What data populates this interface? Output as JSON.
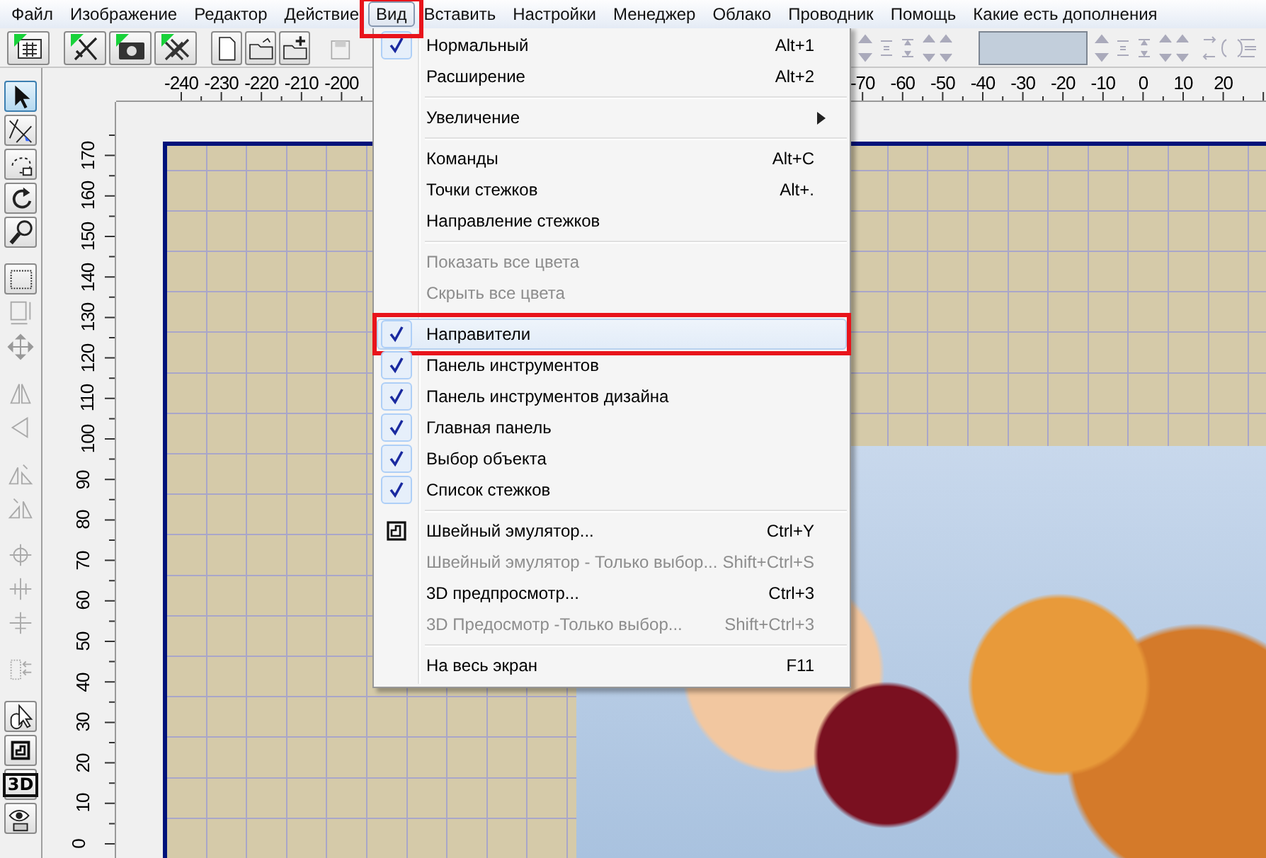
{
  "menubar": [
    {
      "label": "Файл",
      "selected": false,
      "annotated": false
    },
    {
      "label": "Изображение",
      "selected": false,
      "annotated": false
    },
    {
      "label": "Редактор",
      "selected": false,
      "annotated": false
    },
    {
      "label": "Действие",
      "selected": false,
      "annotated": false
    },
    {
      "label": "Вид",
      "selected": true,
      "annotated": true
    },
    {
      "label": "Вставить",
      "selected": false,
      "annotated": false
    },
    {
      "label": "Настройки",
      "selected": false,
      "annotated": false
    },
    {
      "label": "Менеджер",
      "selected": false,
      "annotated": false
    },
    {
      "label": "Облако",
      "selected": false,
      "annotated": false
    },
    {
      "label": "Проводник",
      "selected": false,
      "annotated": false
    },
    {
      "label": "Помощь",
      "selected": false,
      "annotated": false
    },
    {
      "label": "Какие есть дополнения",
      "selected": false,
      "annotated": false
    }
  ],
  "toolbar": {
    "buttons": [
      {
        "disabled": false
      },
      {
        "disabled": false
      },
      {
        "disabled": false
      },
      {
        "disabled": false
      },
      {
        "disabled": false
      },
      {
        "disabled": false
      },
      {
        "disabled": false
      },
      {
        "disabled": true
      }
    ]
  },
  "tools": [
    {
      "kind": "tool",
      "selected": true,
      "disabled": false
    },
    {
      "kind": "tool",
      "selected": false,
      "disabled": false
    },
    {
      "kind": "tool",
      "selected": false,
      "disabled": false
    },
    {
      "kind": "tool",
      "selected": false,
      "disabled": false
    },
    {
      "kind": "tool",
      "selected": false,
      "disabled": false
    },
    {
      "kind": "gap"
    },
    {
      "kind": "tool",
      "selected": false,
      "disabled": false
    },
    {
      "kind": "tool",
      "selected": false,
      "disabled": true
    },
    {
      "kind": "tool",
      "selected": false,
      "disabled": true
    },
    {
      "kind": "gap"
    },
    {
      "kind": "tool",
      "selected": false,
      "disabled": true
    },
    {
      "kind": "tool",
      "selected": false,
      "disabled": true
    },
    {
      "kind": "gap"
    },
    {
      "kind": "tool",
      "selected": false,
      "disabled": true
    },
    {
      "kind": "tool",
      "selected": false,
      "disabled": true
    },
    {
      "kind": "gap"
    },
    {
      "kind": "tool",
      "selected": false,
      "disabled": true
    },
    {
      "kind": "tool",
      "selected": false,
      "disabled": true
    },
    {
      "kind": "tool",
      "selected": false,
      "disabled": true
    },
    {
      "kind": "gap"
    },
    {
      "kind": "tool",
      "selected": false,
      "disabled": true
    },
    {
      "kind": "gap"
    },
    {
      "kind": "tool",
      "selected": false,
      "disabled": false
    },
    {
      "kind": "tool",
      "selected": false,
      "disabled": false
    },
    {
      "kind": "text_tool",
      "label": "3D",
      "selected": false,
      "disabled": false
    },
    {
      "kind": "tool",
      "selected": false,
      "disabled": false
    }
  ],
  "ruler_h": [
    "-240",
    "-230",
    "-220",
    "-210",
    "-200",
    "-70",
    "-60",
    "-50",
    "-40",
    "-30",
    "-20",
    "-10",
    "0",
    "10",
    "20"
  ],
  "ruler_v": [
    "170",
    "160",
    "150",
    "140",
    "130",
    "120",
    "110",
    "100",
    "90",
    "80",
    "70",
    "60",
    "50",
    "40",
    "30",
    "20",
    "10",
    "0"
  ],
  "menu": [
    {
      "kind": "item",
      "label": "Нормальный",
      "shortcut": "Alt+1",
      "checked": true,
      "disabled": false,
      "highlighted": false,
      "submenu": false,
      "annotated": false
    },
    {
      "kind": "item",
      "label": "Расширение",
      "shortcut": "Alt+2",
      "checked": false,
      "disabled": false,
      "highlighted": false,
      "submenu": false,
      "annotated": false
    },
    {
      "kind": "separator"
    },
    {
      "kind": "item",
      "label": "Увеличение",
      "checked": false,
      "disabled": false,
      "highlighted": false,
      "submenu": true,
      "annotated": false
    },
    {
      "kind": "separator"
    },
    {
      "kind": "item",
      "label": "Команды",
      "shortcut": "Alt+C",
      "checked": false,
      "disabled": false,
      "highlighted": false,
      "submenu": false,
      "annotated": false
    },
    {
      "kind": "item",
      "label": "Точки стежков",
      "shortcut": "Alt+.",
      "checked": false,
      "disabled": false,
      "highlighted": false,
      "submenu": false,
      "annotated": false
    },
    {
      "kind": "item",
      "label": "Направление стежков",
      "checked": false,
      "disabled": false,
      "highlighted": false,
      "submenu": false,
      "annotated": false
    },
    {
      "kind": "separator"
    },
    {
      "kind": "item",
      "label": "Показать все цвета",
      "checked": false,
      "disabled": true,
      "highlighted": false,
      "submenu": false,
      "annotated": false
    },
    {
      "kind": "item",
      "label": "Скрыть все цвета",
      "checked": false,
      "disabled": true,
      "highlighted": false,
      "submenu": false,
      "annotated": false
    },
    {
      "kind": "separator"
    },
    {
      "kind": "item",
      "label": "Направители",
      "checked": true,
      "disabled": false,
      "highlighted": true,
      "submenu": false,
      "annotated": true
    },
    {
      "kind": "item",
      "label": "Панель инструментов",
      "checked": true,
      "disabled": false,
      "highlighted": false,
      "submenu": false,
      "annotated": false
    },
    {
      "kind": "item",
      "label": "Панель инструментов дизайна",
      "checked": true,
      "disabled": false,
      "highlighted": false,
      "submenu": false,
      "annotated": false
    },
    {
      "kind": "item",
      "label": "Главная панель",
      "checked": true,
      "disabled": false,
      "highlighted": false,
      "submenu": false,
      "annotated": false
    },
    {
      "kind": "item",
      "label": "Выбор объекта",
      "checked": true,
      "disabled": false,
      "highlighted": false,
      "submenu": false,
      "annotated": false
    },
    {
      "kind": "item",
      "label": "Список стежков",
      "checked": true,
      "disabled": false,
      "highlighted": false,
      "submenu": false,
      "annotated": false
    },
    {
      "kind": "separator"
    },
    {
      "kind": "icon_item",
      "label": "Швейный эмулятор...",
      "shortcut": "Ctrl+Y",
      "checked": false,
      "disabled": false,
      "highlighted": false,
      "submenu": false,
      "annotated": false
    },
    {
      "kind": "item",
      "label": "Швейный эмулятор - Только выбор...",
      "shortcut": "Shift+Ctrl+S",
      "checked": false,
      "disabled": true,
      "highlighted": false,
      "submenu": false,
      "annotated": false
    },
    {
      "kind": "item",
      "label": "3D предпросмотр...",
      "shortcut": "Ctrl+3",
      "checked": false,
      "disabled": false,
      "highlighted": false,
      "submenu": false,
      "annotated": false
    },
    {
      "kind": "item",
      "label": "3D Предосмотр -Только выбор...",
      "shortcut": "Shift+Ctrl+3",
      "checked": false,
      "disabled": true,
      "highlighted": false,
      "submenu": false,
      "annotated": false
    },
    {
      "kind": "separator"
    },
    {
      "kind": "item",
      "label": "На весь экран",
      "shortcut": "F11",
      "checked": false,
      "disabled": false,
      "highlighted": false,
      "submenu": false,
      "annotated": false
    }
  ]
}
